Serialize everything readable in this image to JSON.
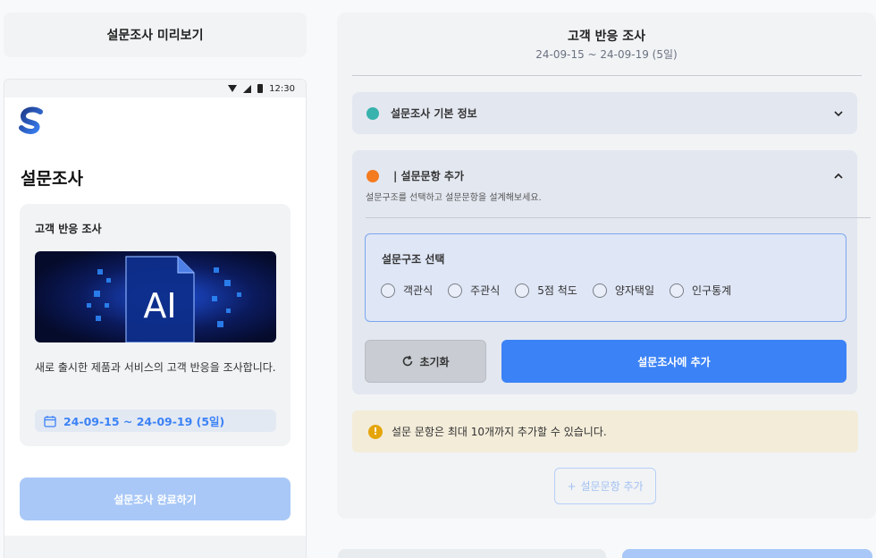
{
  "preview": {
    "header_title": "설문조사 미리보기",
    "status_bar": {
      "time": "12:30"
    },
    "page_title": "설문조사",
    "card": {
      "title": "고객 반응 조사",
      "image_text": "AI",
      "description": "새로 출시한 제품과 서비스의 고객 반응을 조사합니다.",
      "period": "24-09-15 ~ 24-09-19 (5일)"
    },
    "complete_button": "설문조사 완료하기"
  },
  "editor": {
    "title": "고객 반응 조사",
    "period": "24-09-15 ~ 24-09-19 (5일)",
    "basic_info": {
      "label": "설문조사 기본 정보"
    },
    "question_section": {
      "label": "| 설문문항 추가",
      "description": "설문구조를 선택하고 설문문항을 설계해보세요.",
      "structure_title": "설문구조 선택",
      "options": [
        "객관식",
        "주관식",
        "5점 척도",
        "양자택일",
        "인구통계"
      ],
      "reset_button": "초기화",
      "add_button": "설문조사에 추가"
    },
    "notice": "설문 문항은 최대 10개까지 추가할 수 있습니다.",
    "add_question_button": "설문문항 추가"
  },
  "colors": {
    "primary": "#3b82f6",
    "primary_disabled": "#a9c8f7",
    "teal_dot": "#38b2ac",
    "orange_dot": "#f47b20",
    "warning": "#e5a50a"
  }
}
